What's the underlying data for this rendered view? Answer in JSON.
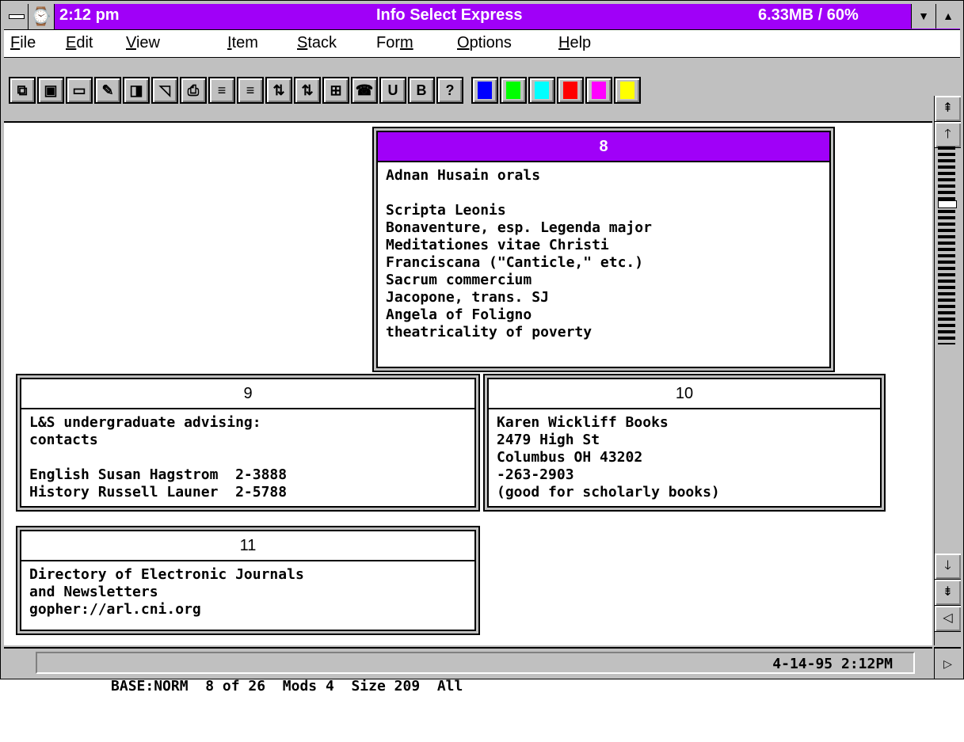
{
  "titlebar": {
    "time": "2:12 pm",
    "app_title": "Info Select Express",
    "memory": "6.33MB / 60%",
    "system_menu_icon": "system-menu-icon",
    "clock_icon": "clock-icon",
    "minimize_glyph": "▼",
    "maximize_glyph": "▲"
  },
  "menubar": {
    "items": [
      {
        "key": "F",
        "rest": "ile"
      },
      {
        "key": "E",
        "rest": "dit"
      },
      {
        "key": "V",
        "rest": "iew"
      },
      {
        "key": "I",
        "rest": "tem"
      },
      {
        "key": "S",
        "rest": "tack"
      },
      {
        "pre": "For",
        "key": "m",
        "rest": ""
      },
      {
        "key": "O",
        "rest": "ptions"
      },
      {
        "key": "H",
        "rest": "elp"
      }
    ]
  },
  "toolbar": {
    "buttons": [
      {
        "name": "cascade-icon",
        "glyph": "⧉"
      },
      {
        "name": "save-icon",
        "glyph": "▣"
      },
      {
        "name": "note-icon",
        "glyph": "▭"
      },
      {
        "name": "pencil-icon",
        "glyph": "✎"
      },
      {
        "name": "window-icon",
        "glyph": "◨"
      },
      {
        "name": "new-page-icon",
        "glyph": "◹"
      },
      {
        "name": "print-icon",
        "glyph": "⎙"
      },
      {
        "name": "sort-up-icon",
        "glyph": "≡"
      },
      {
        "name": "sort-down-icon",
        "glyph": "≡"
      },
      {
        "name": "arrange-a-icon",
        "glyph": "⇅"
      },
      {
        "name": "arrange-b-icon",
        "glyph": "⇅"
      },
      {
        "name": "link-icon",
        "glyph": "⊞"
      },
      {
        "name": "phone-icon",
        "glyph": "☎"
      },
      {
        "name": "underline-icon",
        "glyph": "U"
      },
      {
        "name": "bold-icon",
        "glyph": "B"
      },
      {
        "name": "help-icon",
        "glyph": "?"
      }
    ],
    "colors": [
      "#0000ff",
      "#00ff00",
      "#00ffff",
      "#ff0000",
      "#ff00ff",
      "#ffff00"
    ]
  },
  "notes": [
    {
      "number": "8",
      "active": true,
      "body": "Adnan Husain orals\n\nScripta Leonis\nBonaventure, esp. Legenda major\nMeditationes vitae Christi\nFranciscana (\"Canticle,\" etc.)\nSacrum commercium\nJacopone, trans. SJ\nAngela of Foligno\ntheatricality of poverty"
    },
    {
      "number": "9",
      "active": false,
      "body": "L&S undergraduate advising:\ncontacts\n\nEnglish Susan Hagstrom  2-3888\nHistory Russell Launer  2-5788"
    },
    {
      "number": "10",
      "active": false,
      "body": "Karen Wickliff Books\n2479 High St\nColumbus OH 43202\n-263-2903\n(good for scholarly books)"
    },
    {
      "number": "11",
      "active": false,
      "body": "Directory of Electronic Journals\nand Newsletters\ngopher://arl.cni.org"
    }
  ],
  "scrollbar": {
    "top_glyph": "⇞",
    "up_glyph": "🡑",
    "down_glyph": "🡓",
    "bottom_glyph": "⇟",
    "left_glyph": "◁",
    "right_glyph": "▷"
  },
  "statusbar": {
    "text": "BASE:NORM  8 of 26  Mods 4  Size 209  All",
    "datetime": "4-14-95 2:12PM"
  }
}
